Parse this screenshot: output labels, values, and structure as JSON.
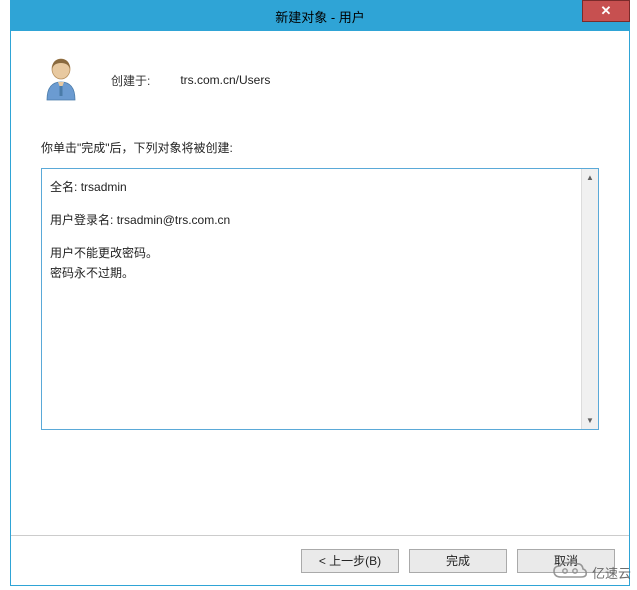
{
  "window": {
    "title": "新建对象 - 用户"
  },
  "header": {
    "created_in_label": "创建于:",
    "created_in_path": "trs.com.cn/Users"
  },
  "prompt": "你单击\"完成\"后，下列对象将被创建:",
  "summary": {
    "full_name_label": "全名:",
    "full_name_value": "trsadmin",
    "logon_name_label": "用户登录名:",
    "logon_name_value": "trsadmin@trs.com.cn",
    "cannot_change_pw": "用户不能更改密码。",
    "pw_never_expires": "密码永不过期。"
  },
  "buttons": {
    "back": "< 上一步(B)",
    "finish": "完成",
    "cancel": "取消"
  },
  "watermark": {
    "text": "亿速云"
  }
}
